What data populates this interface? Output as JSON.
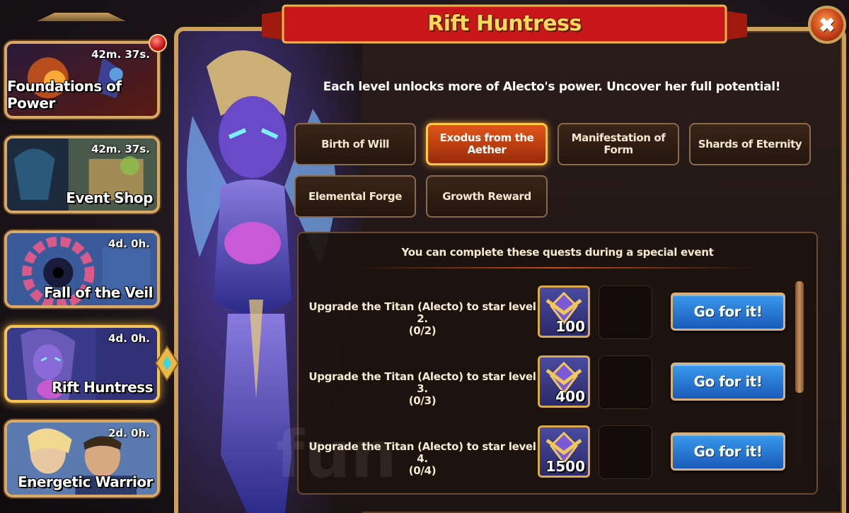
{
  "sidebar": {
    "items": [
      {
        "title": "Foundations of Power",
        "timer": "42m. 37s."
      },
      {
        "title": "Event Shop",
        "timer": "42m. 37s."
      },
      {
        "title": "Fall of the Veil",
        "timer": "4d. 0h."
      },
      {
        "title": "Rift Huntress",
        "timer": "4d. 0h."
      },
      {
        "title": "Energetic Warrior",
        "timer": "2d. 0h."
      }
    ]
  },
  "dialog": {
    "title": "Rift Huntress",
    "subtitle": "Each level unlocks more of Alecto's power. Uncover her full potential!",
    "tabs": [
      {
        "label": "Birth of Will"
      },
      {
        "label": "Exodus from the Aether"
      },
      {
        "label": "Manifestation of Form"
      },
      {
        "label": "Shards of Eternity"
      },
      {
        "label": "Elemental Forge"
      },
      {
        "label": "Growth Reward"
      }
    ],
    "selected_tab": "Exodus from the Aether",
    "quests_header": "You can complete these quests during a special event",
    "quests": [
      {
        "text": "Upgrade the Titan (Alecto) to star level 2.",
        "progress": "(0/2)",
        "reward": "100",
        "button": "Go for it!"
      },
      {
        "text": "Upgrade the Titan (Alecto) to star level 3.",
        "progress": "(0/3)",
        "reward": "400",
        "button": "Go for it!"
      },
      {
        "text": "Upgrade the Titan (Alecto) to star level 4.",
        "progress": "(0/4)",
        "reward": "1500",
        "button": "Go for it!"
      }
    ]
  },
  "icons": {
    "close": "close-icon",
    "reward": "titan-star-crest-icon",
    "notification": "notification-dot-icon"
  },
  "colors": {
    "accent_gold": "#ffd75a",
    "selected_tab": "#e0561a",
    "go_button": "#2a7ad8",
    "frame": "#c9a15a"
  },
  "watermark": "fun"
}
